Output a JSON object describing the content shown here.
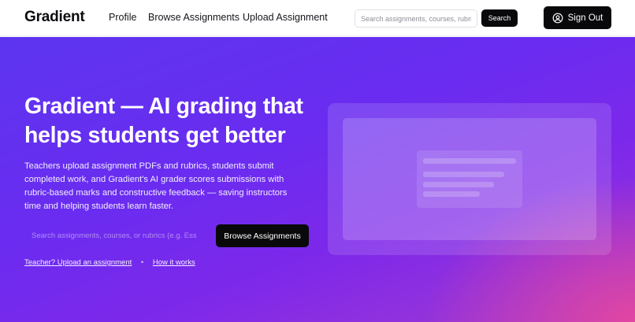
{
  "nav": {
    "logo": "Gradient",
    "links": [
      "Profile",
      "Browse Assignments",
      "Upload Assignment"
    ],
    "search_placeholder": "Search assignments, courses, rubrics",
    "search_button": "Search",
    "signout_label": "Sign Out",
    "signout_icon": "user-circle-icon"
  },
  "hero": {
    "title": "Gradient — AI grading that helps students get better",
    "description": "Teachers upload assignment PDFs and rubrics, students submit completed work, and Gradient's AI grader scores submissions with rubric-based marks and constructive feedback — saving instructors time and helping students learn faster.",
    "search_placeholder": "Search assignments, courses, or rubrics (e.g. Ess",
    "browse_button": "Browse Assignments",
    "link_upload": "Teacher? Upload an assignment",
    "separator": "•",
    "link_how": "How it works"
  }
}
